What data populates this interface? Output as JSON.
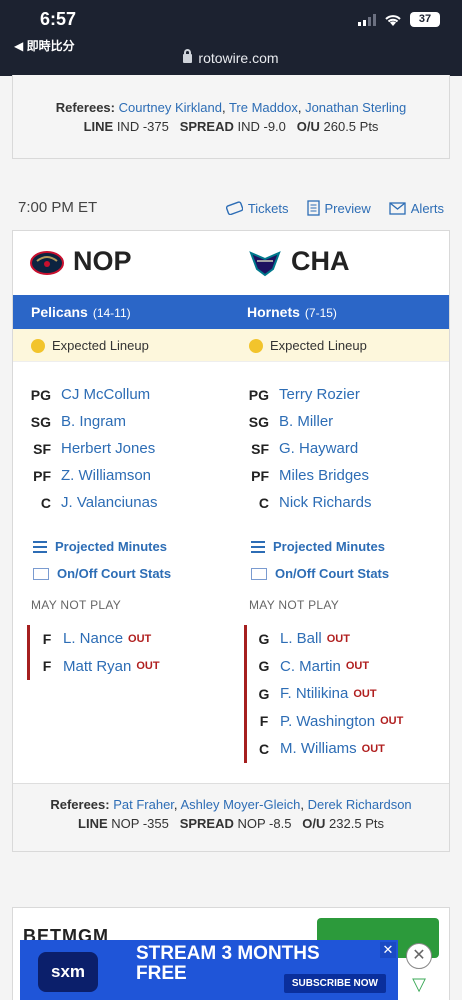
{
  "status_bar": {
    "time": "6:57",
    "back_app": "◀ 即時比分",
    "battery": "37"
  },
  "browser": {
    "url": "rotowire.com"
  },
  "prev_game": {
    "referees_label": "Referees:",
    "referees": [
      "Courtney Kirkland",
      "Tre Maddox",
      "Jonathan Sterling"
    ],
    "line_label": "LINE",
    "line_value": "IND -375",
    "spread_label": "SPREAD",
    "spread_value": "IND -9.0",
    "ou_label": "O/U",
    "ou_value": "260.5 Pts"
  },
  "game": {
    "time": "7:00 PM ET",
    "links": {
      "tickets": "Tickets",
      "preview": "Preview",
      "alerts": "Alerts"
    },
    "away": {
      "abbr": "NOP",
      "name": "Pelicans",
      "record": "(14-11)",
      "lineup_status": "Expected Lineup",
      "lineup": [
        {
          "pos": "PG",
          "name": "CJ McCollum"
        },
        {
          "pos": "SG",
          "name": "B. Ingram"
        },
        {
          "pos": "SF",
          "name": "Herbert Jones"
        },
        {
          "pos": "PF",
          "name": "Z. Williamson"
        },
        {
          "pos": "C",
          "name": "J. Valanciunas"
        }
      ],
      "tools": {
        "minutes": "Projected Minutes",
        "onoff": "On/Off Court Stats"
      },
      "may_not_play_label": "MAY NOT PLAY",
      "injuries": [
        {
          "pos": "F",
          "name": "L. Nance",
          "status": "OUT"
        },
        {
          "pos": "F",
          "name": "Matt Ryan",
          "status": "OUT"
        }
      ]
    },
    "home": {
      "abbr": "CHA",
      "name": "Hornets",
      "record": "(7-15)",
      "lineup_status": "Expected Lineup",
      "lineup": [
        {
          "pos": "PG",
          "name": "Terry Rozier"
        },
        {
          "pos": "SG",
          "name": "B. Miller"
        },
        {
          "pos": "SF",
          "name": "G. Hayward"
        },
        {
          "pos": "PF",
          "name": "Miles Bridges"
        },
        {
          "pos": "C",
          "name": "Nick Richards"
        }
      ],
      "tools": {
        "minutes": "Projected Minutes",
        "onoff": "On/Off Court Stats"
      },
      "may_not_play_label": "MAY NOT PLAY",
      "injuries": [
        {
          "pos": "G",
          "name": "L. Ball",
          "status": "OUT"
        },
        {
          "pos": "G",
          "name": "C. Martin",
          "status": "OUT"
        },
        {
          "pos": "G",
          "name": "F. Ntilikina",
          "status": "OUT"
        },
        {
          "pos": "F",
          "name": "P. Washington",
          "status": "OUT"
        },
        {
          "pos": "C",
          "name": "M. Williams",
          "status": "OUT"
        }
      ]
    },
    "footer": {
      "referees_label": "Referees:",
      "referees": [
        "Pat Fraher",
        "Ashley Moyer-Gleich",
        "Derek Richardson"
      ],
      "line_label": "LINE",
      "line_value": "NOP -355",
      "spread_label": "SPREAD",
      "spread_value": "NOP -8.5",
      "ou_label": "O/U",
      "ou_value": "232.5 Pts"
    }
  },
  "next_card": {
    "sportsbook": "BETMGM"
  },
  "ad": {
    "brand": "sxm",
    "headline_1": "STREAM 3 MONTHS",
    "headline_2": "FREE",
    "cta": "SUBSCRIBE NOW",
    "close": "✕"
  },
  "colors": {
    "blue_bar": "#2b66c7",
    "link": "#2d6db5",
    "out_red": "#b01e1e",
    "expected_bg": "#fdf7dc"
  }
}
